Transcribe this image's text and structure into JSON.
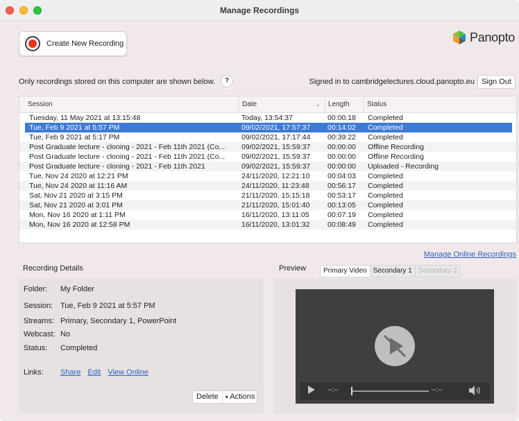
{
  "window": {
    "title": "Manage Recordings"
  },
  "toolbar": {
    "create_label": "Create New Recording"
  },
  "brand": {
    "logo_text": "Panopto",
    "logo_colors": [
      "#58b947",
      "#f6921e",
      "#1b8fd1",
      "#5c5c5c"
    ]
  },
  "notice": {
    "text": "Only recordings stored on this computer are shown below.",
    "help_label": "?"
  },
  "account": {
    "signed_in_text": "Signed in to cambridgelectures.cloud.panopto.eu",
    "sign_out_label": "Sign Out"
  },
  "table": {
    "columns": [
      "Session",
      "Date",
      "Length",
      "Status"
    ],
    "sort_icon": "chevron-down-icon",
    "selected_index": 1,
    "rows": [
      {
        "session": "Tuesday, 11 May 2021 at 13:15:48",
        "date": "Today, 13:54:37",
        "length": "00:00:18",
        "status": "Completed"
      },
      {
        "session": "Tue, Feb 9 2021 at 5:57 PM",
        "date": "09/02/2021, 17:57:37",
        "length": "00:14:02",
        "status": "Completed"
      },
      {
        "session": "Tue, Feb 9 2021 at 5:17 PM",
        "date": "09/02/2021, 17:17:44",
        "length": "00:39:22",
        "status": "Completed"
      },
      {
        "session": "Post Graduate lecture - cloning - 2021 - Feb 11th 2021 (Co...",
        "date": "09/02/2021, 15:59:37",
        "length": "00:00:00",
        "status": "Offline Recording"
      },
      {
        "session": "Post Graduate lecture - cloning - 2021 - Feb 11th 2021 (Co...",
        "date": "09/02/2021, 15:59:37",
        "length": "00:00:00",
        "status": "Offline Recording"
      },
      {
        "session": "Post Graduate lecture - cloning - 2021 - Feb 11th 2021",
        "date": "09/02/2021, 15:59:37",
        "length": "00:00:00",
        "status": "Uploaded - Recording"
      },
      {
        "session": "Tue, Nov 24 2020 at 12:21 PM",
        "date": "24/11/2020, 12:21:10",
        "length": "00:04:03",
        "status": "Completed"
      },
      {
        "session": "Tue, Nov 24 2020 at 11:16 AM",
        "date": "24/11/2020, 11:23:48",
        "length": "00:56:17",
        "status": "Completed"
      },
      {
        "session": "Sat, Nov 21 2020 at 3:15 PM",
        "date": "21/11/2020, 15:15:18",
        "length": "00:53:17",
        "status": "Completed"
      },
      {
        "session": "Sat, Nov 21 2020 at 3:01 PM",
        "date": "21/11/2020, 15:01:40",
        "length": "00:13:05",
        "status": "Completed"
      },
      {
        "session": "Mon, Nov 16 2020 at 1:11 PM",
        "date": "16/11/2020, 13:11:05",
        "length": "00:07:19",
        "status": "Completed"
      },
      {
        "session": "Mon, Nov 16 2020 at 12:58 PM",
        "date": "16/11/2020, 13:01:32",
        "length": "00:08:49",
        "status": "Completed"
      }
    ]
  },
  "online": {
    "manage_link": "Manage Online Recordings"
  },
  "details": {
    "title": "Recording Details",
    "folder_label": "Folder:",
    "folder_value": "My Folder",
    "session_label": "Session:",
    "session_value": "Tue, Feb 9 2021 at 5:57 PM",
    "streams_label": "Streams:",
    "streams_value": "Primary, Secondary 1, PowerPoint",
    "webcast_label": "Webcast:",
    "webcast_value": "No",
    "status_label": "Status:",
    "status_value": "Completed",
    "links_label": "Links:",
    "links": [
      "Share",
      "Edit",
      "View Online"
    ],
    "delete_label": "Delete",
    "actions_label": "Actions"
  },
  "preview": {
    "title": "Preview",
    "tabs": [
      "Primary Video",
      "Secondary 1",
      "Secondary 2"
    ],
    "active_tab": "Primary Video",
    "disabled_tab": "Secondary 2",
    "time_elapsed": "--:--",
    "time_total": "--:--"
  },
  "colors": {
    "selection": "#3d7ad6",
    "link": "#2b63c6",
    "record": "#e8331d",
    "window_bg": "#f1e9e9"
  }
}
